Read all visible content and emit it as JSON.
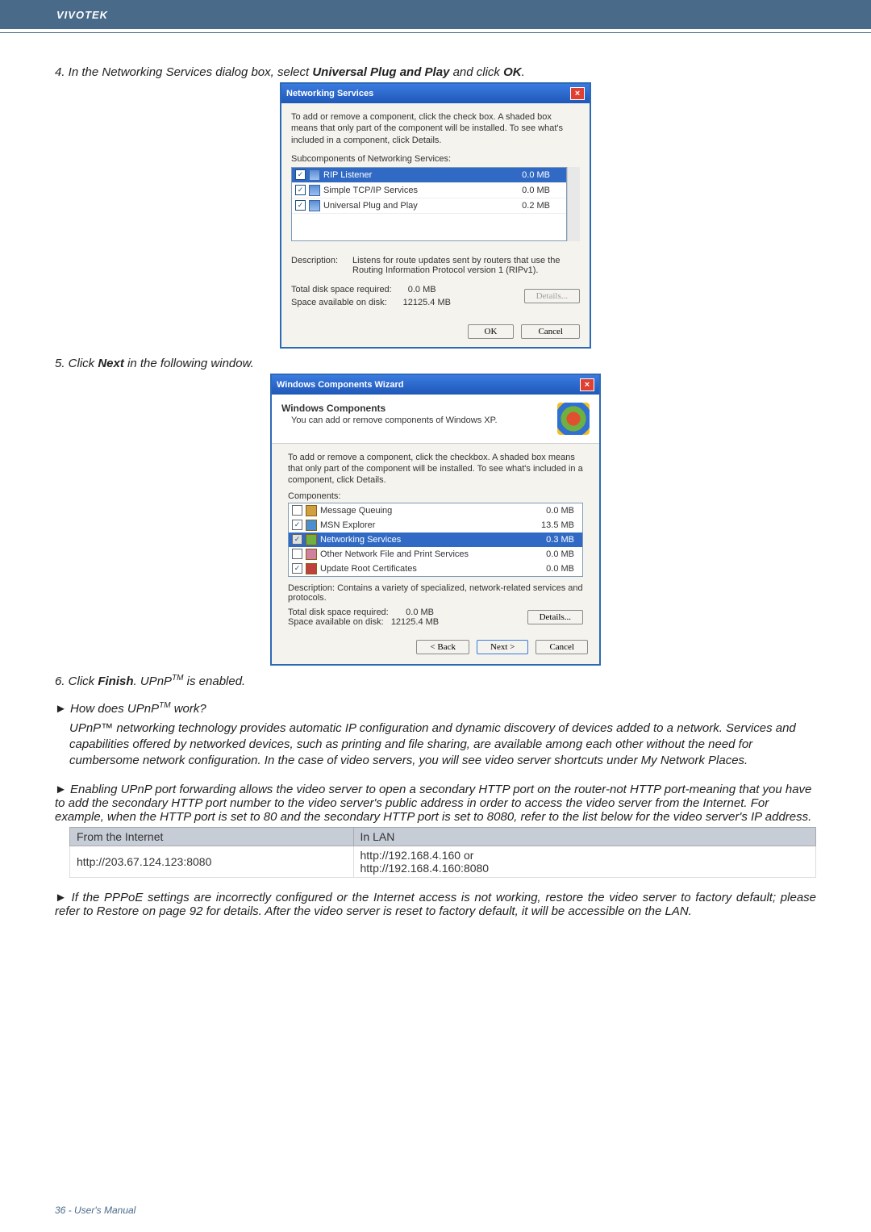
{
  "header": {
    "brand": "VIVOTEK"
  },
  "step4": {
    "prefix": "4. In the Networking Services dialog box, select ",
    "bold1": "Universal Plug and Play",
    "mid": " and click ",
    "bold2": "OK",
    "suffix": "."
  },
  "dlg1": {
    "title": "Networking Services",
    "intro": "To add or remove a component, click the check box. A shaded box means that only part of the component will be installed. To see what's included in a component, click Details.",
    "subLabel": "Subcomponents of Networking Services:",
    "rows": [
      {
        "name": "RIP Listener",
        "size": "0.0 MB",
        "checked": true,
        "selected": true
      },
      {
        "name": "Simple TCP/IP Services",
        "size": "0.0 MB",
        "checked": true,
        "selected": false
      },
      {
        "name": "Universal Plug and Play",
        "size": "0.2 MB",
        "checked": true,
        "selected": false
      }
    ],
    "descLabel": "Description:",
    "descText": "Listens for route updates sent by routers that use the Routing Information Protocol version 1 (RIPv1).",
    "reqLabel": "Total disk space required:",
    "reqVal": "0.0 MB",
    "availLabel": "Space available on disk:",
    "availVal": "12125.4 MB",
    "detailsBtn": "Details...",
    "okBtn": "OK",
    "cancelBtn": "Cancel"
  },
  "step5": {
    "prefix": "5. Click ",
    "bold": "Next",
    "suffix": " in the following window."
  },
  "dlg2": {
    "title": "Windows Components Wizard",
    "headTitle": "Windows Components",
    "headSub": "You can add or remove components of Windows XP.",
    "intro": "To add or remove a component, click the checkbox. A shaded box means that only part of the component will be installed. To see what's included in a component, click Details.",
    "compLabel": "Components:",
    "rows": [
      {
        "name": "Message Queuing",
        "size": "0.0 MB",
        "chkState": "unchecked"
      },
      {
        "name": "MSN Explorer",
        "size": "13.5 MB",
        "chkState": "checked"
      },
      {
        "name": "Networking Services",
        "size": "0.3 MB",
        "chkState": "checked",
        "selected": true
      },
      {
        "name": "Other Network File and Print Services",
        "size": "0.0 MB",
        "chkState": "unchecked"
      },
      {
        "name": "Update Root Certificates",
        "size": "0.0 MB",
        "chkState": "checked"
      }
    ],
    "descLabel": "Description:",
    "descText": "Contains a variety of specialized, network-related services and protocols.",
    "reqLabel": "Total disk space required:",
    "reqVal": "0.0 MB",
    "availLabel": "Space available on disk:",
    "availVal": "12125.4 MB",
    "detailsBtn": "Details...",
    "backBtn": "< Back",
    "nextBtn": "Next >",
    "cancelBtn": "Cancel"
  },
  "step6": {
    "prefix": "6. Click ",
    "bold": "Finish",
    "mid": ". UPnP",
    "suffix": " is enabled."
  },
  "q1": {
    "heading": "How does UPnP",
    "headingSuffix": " work?",
    "body": "UPnP™ networking technology provides automatic IP configuration and dynamic discovery of devices added to a network. Services and capabilities offered by networked devices, such as printing and file sharing, are available among each other without the need for cumbersome network configuration. In the case of video servers, you will see video server shortcuts under My Network Places."
  },
  "q2": {
    "body": "Enabling UPnP port forwarding allows the video server to open a secondary HTTP port on the router-not HTTP port-meaning that you have to add the secondary HTTP port number to the video server's public address in order to access the video server from the Internet. For example, when the HTTP port is set to 80 and the secondary HTTP port is set to 8080, refer to the list below for the video server's IP address."
  },
  "table": {
    "h1": "From the Internet",
    "h2": "In LAN",
    "c1": "http://203.67.124.123:8080",
    "c2a": "http://192.168.4.160 or",
    "c2b": "http://192.168.4.160:8080"
  },
  "q3": {
    "body": "If the PPPoE settings are incorrectly configured or the Internet access is not working, restore the video server to factory default; please refer to Restore on page 92 for details. After the video server is reset to factory default, it will be accessible on the LAN."
  },
  "footer": {
    "text": "36 - User's Manual"
  }
}
